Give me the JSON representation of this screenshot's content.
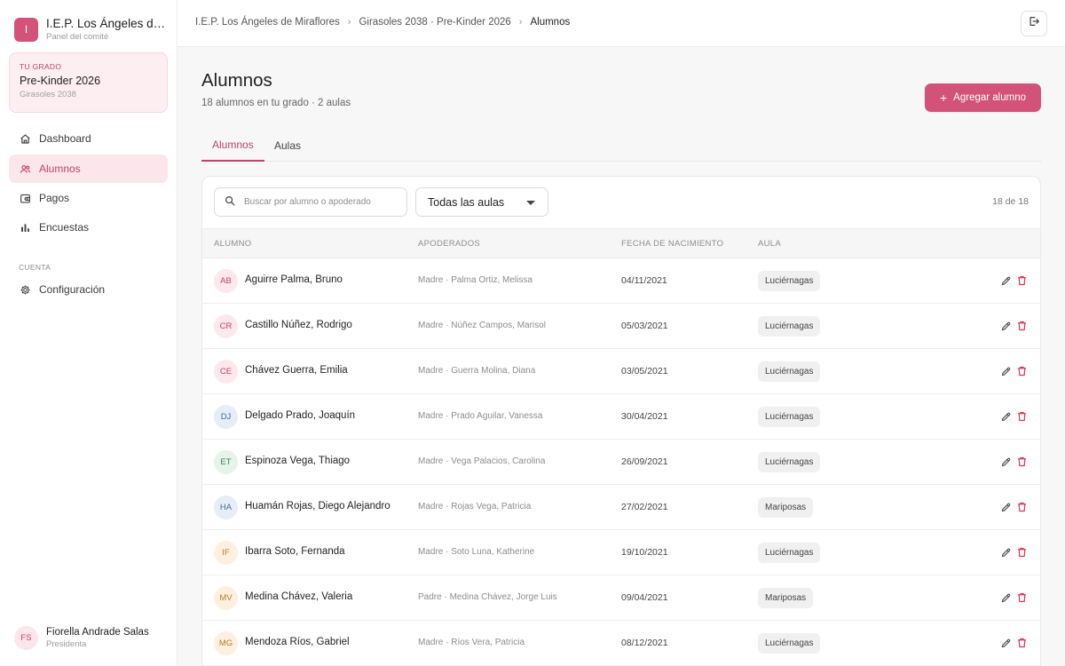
{
  "sidebar": {
    "brand": {
      "initial": "I",
      "name": "I.E.P. Los Ángeles de ...",
      "subtitle": "Panel del comité"
    },
    "grade_card": {
      "eyebrow": "TU GRADO",
      "title": "Pre-Kinder 2026",
      "subtitle": "Girasoles 2038"
    },
    "nav": [
      {
        "label": "Dashboard",
        "icon": "home-icon"
      },
      {
        "label": "Alumnos",
        "icon": "users-icon",
        "active": true
      },
      {
        "label": "Pagos",
        "icon": "wallet-icon"
      },
      {
        "label": "Encuestas",
        "icon": "bar-chart-icon"
      }
    ],
    "section_label": "CUENTA",
    "settings": {
      "label": "Configuración",
      "icon": "gear-icon"
    },
    "user": {
      "initials": "FS",
      "name": "Fiorella Andrade Salas",
      "role": "Presidenta"
    }
  },
  "topbar": {
    "breadcrumb": [
      "I.E.P. Los Ángeles de Miraflores",
      "Girasoles 2038 · Pre-Kinder 2026",
      "Alumnos"
    ],
    "logout_icon": "logout-icon"
  },
  "main": {
    "title": "Alumnos",
    "subtitle": "18 alumnos en tu grado · 2 aulas",
    "add_button": {
      "icon": "+",
      "label": "Agregar alumno"
    },
    "tabs": [
      "Alumnos",
      "Aulas"
    ],
    "search": {
      "placeholder": "Buscar por alumno o apoderado",
      "value": ""
    },
    "aula_filter": {
      "selected": "Todas las aulas"
    },
    "count": "18 de 18",
    "columns": [
      "ALUMNO",
      "APODERADOS",
      "FECHA DE NACIMIENTO",
      "AULA"
    ],
    "rows": [
      {
        "initials": "AB",
        "name": "Aguirre Palma, Bruno",
        "guardian": "Madre · Palma Ortiz, Melissa",
        "dob": "04/11/2021",
        "aula": "Luciérnagas",
        "avatar_bg": "#fde8ee",
        "avatar_fg": "#c2436b"
      },
      {
        "initials": "CR",
        "name": "Castillo Núñez, Rodrigo",
        "guardian": "Madre · Núñez Campos, Marisol",
        "dob": "05/03/2021",
        "aula": "Luciérnagas",
        "avatar_bg": "#fde8ee",
        "avatar_fg": "#c2436b"
      },
      {
        "initials": "CE",
        "name": "Chávez Guerra, Emilia",
        "guardian": "Madre · Guerra Molina, Diana",
        "dob": "03/05/2021",
        "aula": "Luciérnagas",
        "avatar_bg": "#fde8ee",
        "avatar_fg": "#c2436b"
      },
      {
        "initials": "DJ",
        "name": "Delgado Prado, Joaquín",
        "guardian": "Madre · Prado Aguilar, Vanessa",
        "dob": "30/04/2021",
        "aula": "Luciérnagas",
        "avatar_bg": "#e6edf7",
        "avatar_fg": "#4a6a9c"
      },
      {
        "initials": "ET",
        "name": "Espinoza Vega, Thiago",
        "guardian": "Madre · Vega Palacios, Carolina",
        "dob": "26/09/2021",
        "aula": "Luciérnagas",
        "avatar_bg": "#e5f3ea",
        "avatar_fg": "#3f7d56"
      },
      {
        "initials": "HA",
        "name": "Huamán Rojas, Diego Alejandro",
        "guardian": "Madre · Rojas Vega, Patricia",
        "dob": "27/02/2021",
        "aula": "Mariposas",
        "avatar_bg": "#e6edf7",
        "avatar_fg": "#4a6a9c"
      },
      {
        "initials": "IF",
        "name": "Ibarra Soto, Fernanda",
        "guardian": "Madre · Soto Luna, Katherine",
        "dob": "19/10/2021",
        "aula": "Luciérnagas",
        "avatar_bg": "#fdf0df",
        "avatar_fg": "#b9792c"
      },
      {
        "initials": "MV",
        "name": "Medina Chávez, Valeria",
        "guardian": "Padre · Medina Chávez, Jorge Luis",
        "dob": "09/04/2021",
        "aula": "Mariposas",
        "avatar_bg": "#fdf0df",
        "avatar_fg": "#b9792c"
      },
      {
        "initials": "MG",
        "name": "Mendoza Ríos, Gabriel",
        "guardian": "Madre · Ríos Vera, Patricia",
        "dob": "08/12/2021",
        "aula": "Luciérnagas",
        "avatar_bg": "#fdf0df",
        "avatar_fg": "#b9792c"
      }
    ]
  },
  "colors": {
    "accent": "#d2527a",
    "accent_text": "#c2436b",
    "accent_soft": "#fbe6ec",
    "delete": "#e0364f"
  }
}
